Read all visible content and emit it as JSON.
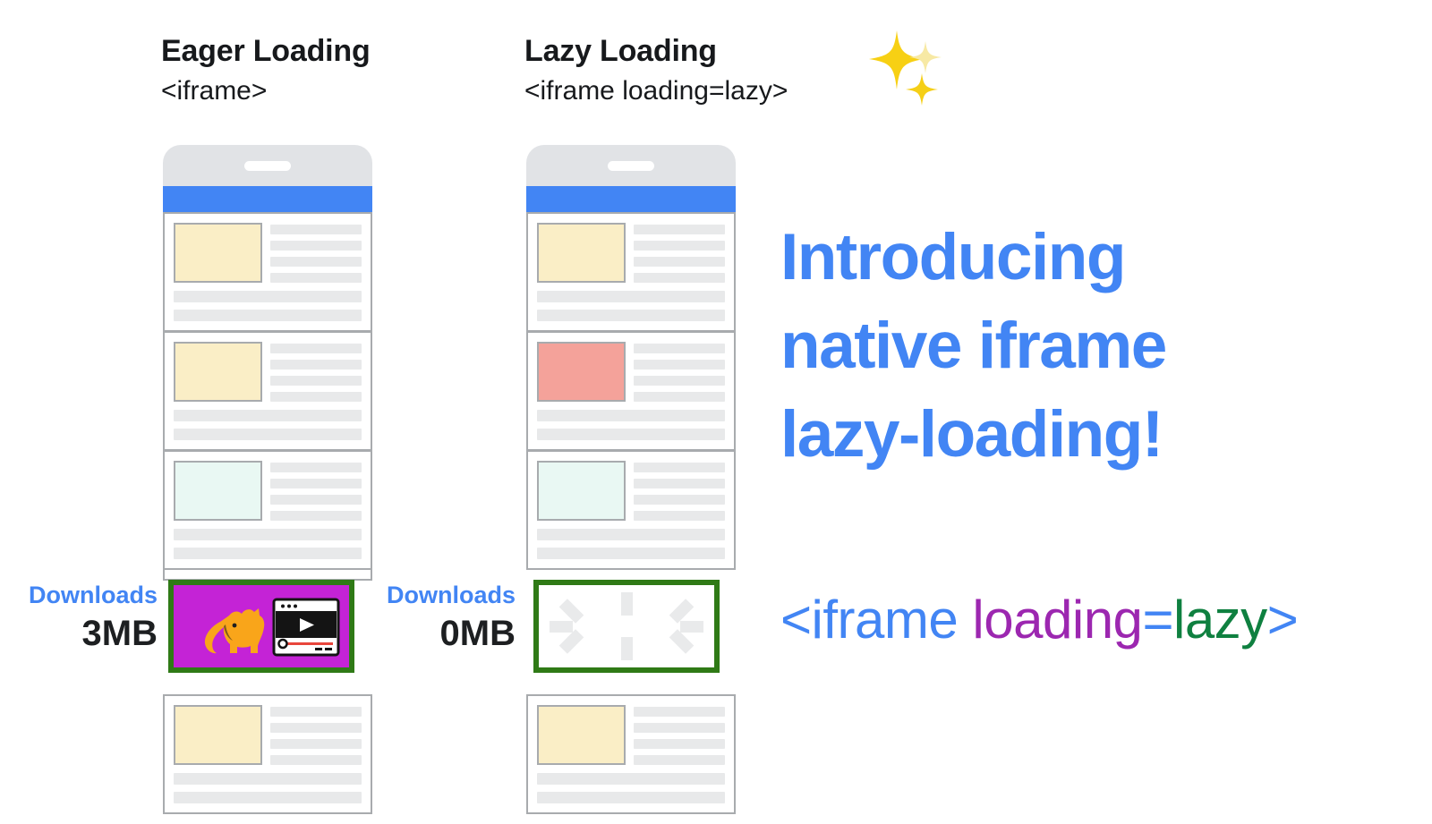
{
  "columns": [
    {
      "id": "eager",
      "title": "Eager Loading",
      "subtitle": "<iframe>",
      "downloads_label": "Downloads",
      "downloads_value": "3MB",
      "iframe_state": "loaded",
      "iframe_content": "dog-video-thumbnail"
    },
    {
      "id": "lazy",
      "title": "Lazy Loading",
      "subtitle": "<iframe loading=lazy>",
      "downloads_label": "Downloads",
      "downloads_value": "0MB",
      "iframe_state": "placeholder",
      "iframe_content": "loading-spinner",
      "emoji": "sparkles"
    }
  ],
  "headline": {
    "line1": "Introducing",
    "line2": "native iframe",
    "line3": "lazy-loading!"
  },
  "code_snippet": {
    "tag_open": "<iframe",
    "attribute": " loading",
    "equals": "=",
    "value": "lazy",
    "tag_close": ">"
  },
  "colors": {
    "accent_blue": "#4285f4",
    "phone_chrome": "#e1e3e6",
    "card_border": "#a8abae",
    "placeholder_line": "#e8e9ea",
    "iframe_border_green": "#2f7a16",
    "iframe_fill_purple": "#c423d6",
    "dog_gold": "#f9a51a",
    "code_attribute_purple": "#9c27b0",
    "code_value_green": "#0f8040",
    "text_dark": "#17191c",
    "thumb_cream": "#faeec6",
    "thumb_salmon": "#f4a29a",
    "thumb_mint": "#e9f8f3"
  },
  "card_thumbnails": [
    "cream",
    "salmon",
    "mint",
    "cream"
  ]
}
